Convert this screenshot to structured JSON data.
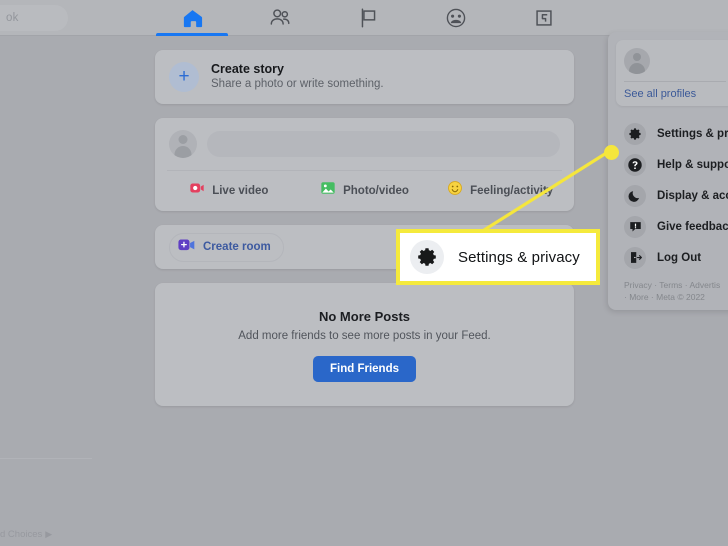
{
  "topbar": {
    "search_text": "ok",
    "nav_items": [
      {
        "name": "home",
        "label": "Home",
        "active": true
      },
      {
        "name": "friends",
        "label": "Friends",
        "active": false
      },
      {
        "name": "pages",
        "label": "Pages",
        "active": false
      },
      {
        "name": "groups",
        "label": "Groups",
        "active": false
      },
      {
        "name": "gaming",
        "label": "Gaming",
        "active": false
      }
    ]
  },
  "feed": {
    "create_story": {
      "title": "Create story",
      "subtitle": "Share a photo or write something.",
      "icon": "plus-icon"
    },
    "composer": {
      "actions": [
        {
          "label": "Live video",
          "icon": "live-video-icon",
          "color": "#e4405f"
        },
        {
          "label": "Photo/video",
          "icon": "photo-video-icon",
          "color": "#45bd62"
        },
        {
          "label": "Feeling/activity",
          "icon": "feeling-activity-icon",
          "color": "#f7b928"
        }
      ]
    },
    "create_room": {
      "label": "Create room",
      "icon": "video-room-icon"
    },
    "no_more_posts": {
      "title": "No More Posts",
      "subtitle": "Add more friends to see more posts in your Feed.",
      "button_label": "Find Friends"
    }
  },
  "dropdown": {
    "profile_card": {
      "see_all_label": "See all profiles",
      "avatar_icon": "user-avatar-icon"
    },
    "items": [
      {
        "label": "Settings & priv",
        "icon": "gear-icon"
      },
      {
        "label": "Help & support",
        "icon": "question-mark-icon"
      },
      {
        "label": "Display & acce",
        "icon": "moon-icon"
      },
      {
        "label": "Give feedback",
        "icon": "feedback-icon"
      },
      {
        "label": "Log Out",
        "icon": "logout-icon"
      }
    ],
    "footer_line1": "Privacy · Terms · Advertis",
    "footer_line2": "· More · Meta © 2022"
  },
  "left_sidebar": {
    "ad_choices_label": "d Choices",
    "ad_choices_glyph": "▶"
  },
  "callout": {
    "label": "Settings & privacy",
    "icon": "gear-icon",
    "border_color": "#f5ea3c",
    "background": "#ffffff",
    "marker_color": "#f5e63c"
  },
  "colors": {
    "overlay": "#a9abb0",
    "accent_blue": "#1877f2",
    "highlight_yellow": "#f5ea3c",
    "link_blue": "#3b5998"
  }
}
